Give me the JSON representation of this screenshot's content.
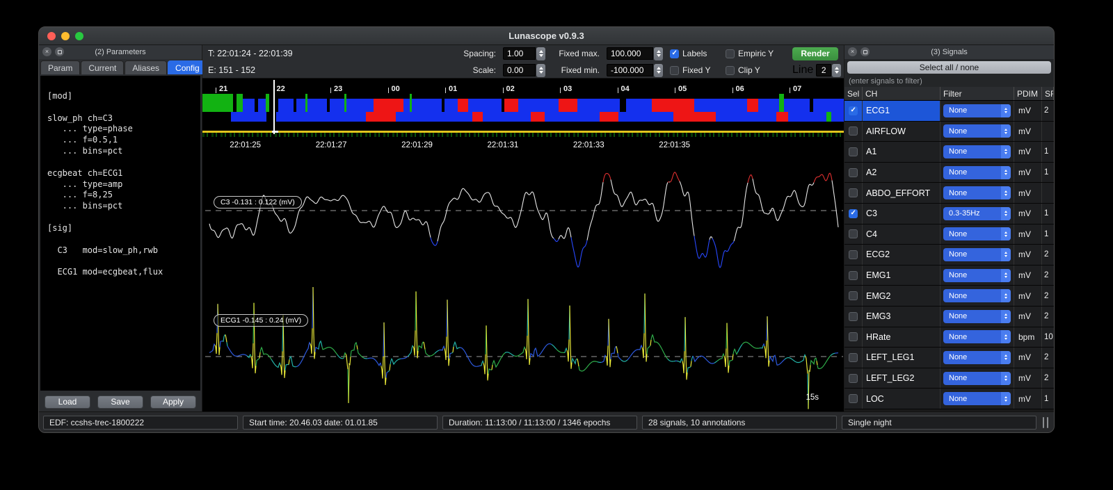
{
  "window": {
    "title": "Lunascope v0.9.3"
  },
  "colors": {
    "accent": "#2a6be6",
    "accent_dark": "#1d56d8",
    "render_green": "#3f9b43",
    "popup_blue": "#3464dd",
    "popup_cap": "#4a7df0",
    "yellow_line": "#e2c31c",
    "stage_wake": "#12b212",
    "stage_nrem": "#1430ee",
    "stage_rem": "#ee1515",
    "stage_gap": "#000000"
  },
  "left_panel": {
    "title": "(2) Parameters",
    "tabs": [
      "Param",
      "Current",
      "Aliases",
      "Config"
    ],
    "active_tab": "Config",
    "config_text": "[mod]\n\nslow_ph ch=C3\n   ... type=phase\n   ... f=0.5,1\n   ... bins=pct\n\necgbeat ch=ECG1\n   ... type=amp\n   ... f=8,25\n   ... bins=pct\n\n[sig]\n\n  C3   mod=slow_ph,rwb\n\n  ECG1 mod=ecgbeat,flux",
    "buttons": [
      "Load",
      "Save",
      "Apply"
    ]
  },
  "toolbar": {
    "time_range": "T: 22:01:24 - 22:01:39",
    "epoch_range": "E: 151 - 152",
    "spacing_label": "Spacing:",
    "spacing_value": "1.00",
    "fixed_max_label": "Fixed max.",
    "fixed_max_value": "100.000",
    "scale_label": "Scale:",
    "scale_value": "0.00",
    "fixed_min_label": "Fixed min.",
    "fixed_min_value": "-100.000",
    "labels_label": "Labels",
    "labels_checked": true,
    "empiric_label": "Empiric Y",
    "empiric_checked": false,
    "fixedy_label": "Fixed Y",
    "fixedy_checked": false,
    "clipy_label": "Clip Y",
    "clipy_checked": false,
    "render_label": "Render",
    "line_label": "Line",
    "line_value": "2"
  },
  "hypnogram": {
    "hours": [
      "21",
      "22",
      "23",
      "00",
      "01",
      "02",
      "03",
      "04",
      "05",
      "06",
      "07"
    ],
    "cursor_epoch": "151",
    "band1": [
      [
        "wake",
        4.8
      ],
      [
        "gap",
        0.5
      ],
      [
        "wake",
        1.0
      ],
      [
        "nrem",
        1.8
      ],
      [
        "gap",
        0.6
      ],
      [
        "nrem",
        1.2
      ],
      [
        "wake",
        0.5
      ],
      [
        "gap",
        1.4
      ],
      [
        "nrem",
        2.4
      ],
      [
        "gap",
        0.4
      ],
      [
        "nrem",
        1.4
      ],
      [
        "wake",
        0.4
      ],
      [
        "nrem",
        3.0
      ],
      [
        "gap",
        0.5
      ],
      [
        "nrem",
        2.2
      ],
      [
        "wake",
        0.4
      ],
      [
        "nrem",
        4.2
      ],
      [
        "rem",
        4.6
      ],
      [
        "nrem",
        1.0
      ],
      [
        "wake",
        0.4
      ],
      [
        "nrem",
        4.6
      ],
      [
        "gap",
        0.5
      ],
      [
        "nrem",
        2.0
      ],
      [
        "rem",
        1.6
      ],
      [
        "nrem",
        5.2
      ],
      [
        "gap",
        0.5
      ],
      [
        "rem",
        2.2
      ],
      [
        "nrem",
        6.2
      ],
      [
        "rem",
        3.0
      ],
      [
        "nrem",
        6.6
      ],
      [
        "gap",
        1.0
      ],
      [
        "nrem",
        4.0
      ],
      [
        "rem",
        6.6
      ],
      [
        "nrem",
        8.2
      ],
      [
        "rem",
        1.8
      ],
      [
        "nrem",
        3.2
      ],
      [
        "wake",
        0.8
      ],
      [
        "nrem",
        4.0
      ],
      [
        "gap",
        0.5
      ],
      [
        "nrem",
        4.8
      ]
    ],
    "band2": [
      [
        "gap",
        4.5
      ],
      [
        "nrem",
        5.5
      ],
      [
        "gap",
        1.5
      ],
      [
        "nrem",
        14.0
      ],
      [
        "rem",
        4.6
      ],
      [
        "nrem",
        12.0
      ],
      [
        "rem",
        1.6
      ],
      [
        "nrem",
        7.5
      ],
      [
        "rem",
        2.2
      ],
      [
        "nrem",
        8.5
      ],
      [
        "rem",
        3.0
      ],
      [
        "nrem",
        8.5
      ],
      [
        "rem",
        6.6
      ],
      [
        "nrem",
        9.5
      ],
      [
        "rem",
        1.8
      ],
      [
        "nrem",
        6.0
      ],
      [
        "wake",
        0.8
      ],
      [
        "nrem",
        1.9
      ]
    ]
  },
  "viewer": {
    "time_labels": [
      "22:01:25",
      "22:01:27",
      "22:01:29",
      "22:01:31",
      "22:01:33",
      "22:01:35"
    ],
    "window_label": "15s",
    "traces": [
      {
        "id": "C3",
        "kind": "eeg",
        "label": "C3 -0.131 : 0.122 (mV)",
        "seed": 11,
        "center_frac": 0.224,
        "amplitude": 82,
        "palette": {
          "high": "#e03030",
          "mid": "#e8e8e8",
          "low": "#2848ff"
        }
      },
      {
        "id": "ECG1",
        "kind": "ecg",
        "label": "ECG1 -0.145 : 0.24 (mV)",
        "seed": 23,
        "center_frac": 0.784,
        "amplitude": 100,
        "palette": {
          "spike": "#e8e838",
          "a": "#2fae4a",
          "b": "#2d5ae0",
          "c": "#23b3a8"
        }
      }
    ]
  },
  "signals_panel": {
    "title": "(3) Signals",
    "select_button": "Select all / none",
    "filter_placeholder": "(enter signals to filter)",
    "columns": [
      "Sel",
      "CH",
      "Filter",
      "PDIM",
      "SR"
    ],
    "rows": [
      {
        "sel": true,
        "ch": "ECG1",
        "filter": "None",
        "pdim": "mV",
        "sr": "2",
        "selected": true
      },
      {
        "sel": false,
        "ch": "AIRFLOW",
        "filter": "None",
        "pdim": "mV",
        "sr": ""
      },
      {
        "sel": false,
        "ch": "A1",
        "filter": "None",
        "pdim": "mV",
        "sr": "1"
      },
      {
        "sel": false,
        "ch": "A2",
        "filter": "None",
        "pdim": "mV",
        "sr": "1"
      },
      {
        "sel": false,
        "ch": "ABDO_EFFORT",
        "filter": "None",
        "pdim": "mV",
        "sr": ""
      },
      {
        "sel": true,
        "ch": "C3",
        "filter": "0.3-35Hz",
        "pdim": "mV",
        "sr": "1"
      },
      {
        "sel": false,
        "ch": "C4",
        "filter": "None",
        "pdim": "mV",
        "sr": "1"
      },
      {
        "sel": false,
        "ch": "ECG2",
        "filter": "None",
        "pdim": "mV",
        "sr": "2"
      },
      {
        "sel": false,
        "ch": "EMG1",
        "filter": "None",
        "pdim": "mV",
        "sr": "2"
      },
      {
        "sel": false,
        "ch": "EMG2",
        "filter": "None",
        "pdim": "mV",
        "sr": "2"
      },
      {
        "sel": false,
        "ch": "EMG3",
        "filter": "None",
        "pdim": "mV",
        "sr": "2"
      },
      {
        "sel": false,
        "ch": "HRate",
        "filter": "None",
        "pdim": "bpm",
        "sr": "10"
      },
      {
        "sel": false,
        "ch": "LEFT_LEG1",
        "filter": "None",
        "pdim": "mV",
        "sr": "2"
      },
      {
        "sel": false,
        "ch": "LEFT_LEG2",
        "filter": "None",
        "pdim": "mV",
        "sr": "2"
      },
      {
        "sel": false,
        "ch": "LOC",
        "filter": "None",
        "pdim": "mV",
        "sr": "1"
      }
    ]
  },
  "status_bar": {
    "fields": [
      "EDF: ccshs-trec-1800222",
      "Start time: 20.46.03 date: 01.01.85",
      "Duration: 11:13:00 / 11:13:00 / 1346 epochs",
      "28 signals, 10 annotations",
      "Single night"
    ]
  }
}
